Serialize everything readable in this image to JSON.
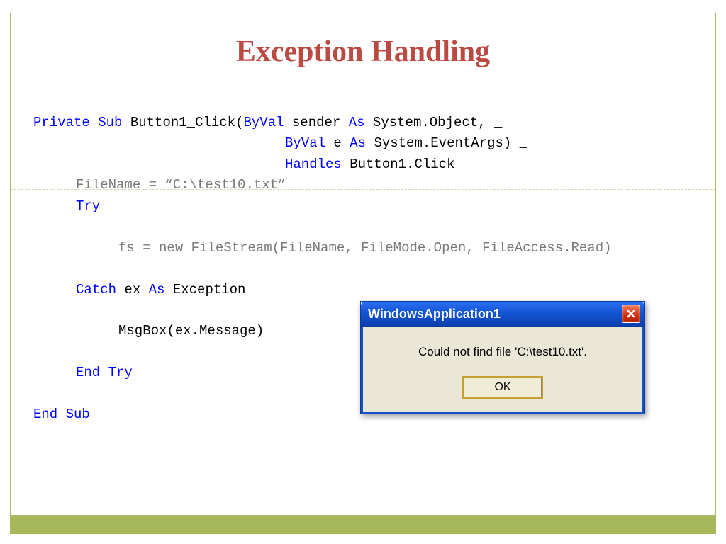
{
  "title": "Exception Handling",
  "code": {
    "l1_private": "Private",
    "l1_sub": "Sub",
    "l1_name": " Button1_Click(",
    "l1_byval": "ByVal",
    "l1_sender": " sender ",
    "l1_as": "As",
    "l1_type": " System.Object, _",
    "l2_byval": "ByVal",
    "l2_e": " e ",
    "l2_as": "As",
    "l2_type": " System.EventArgs) _",
    "l3_handles": "Handles",
    "l3_rest": " Button1.Click",
    "l4": "FileName = “C:\\test10.txt”",
    "l5_try": "Try",
    "l6": "fs = new FileStream(FileName, FileMode.Open, FileAccess.Read)",
    "l7_catch": "Catch",
    "l7_ex": " ex ",
    "l7_as": "As",
    "l7_type": " Exception",
    "l8": "MsgBox(ex.Message)",
    "l9_end": "End",
    "l9_try": " Try",
    "l10_end": "End",
    "l10_sub": " Sub"
  },
  "dialog": {
    "title": "WindowsApplication1",
    "message": "Could not find file 'C:\\test10.txt'.",
    "ok": "OK"
  }
}
